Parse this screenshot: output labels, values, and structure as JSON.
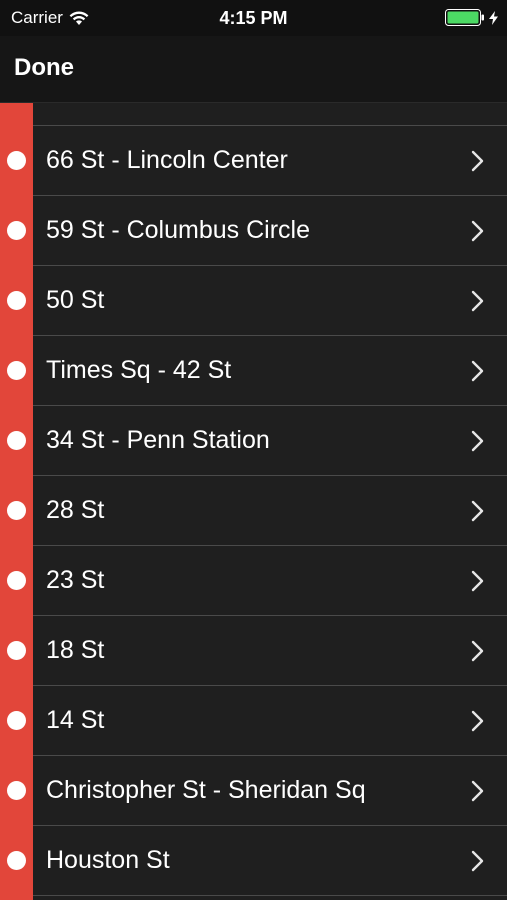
{
  "status_bar": {
    "carrier": "Carrier",
    "time": "4:15 PM",
    "battery_color": "#4cd964"
  },
  "nav": {
    "done_label": "Done"
  },
  "route_color": "#e2463a",
  "stations": [
    {
      "name": "66 St - Lincoln Center"
    },
    {
      "name": "59 St - Columbus Circle"
    },
    {
      "name": "50 St"
    },
    {
      "name": "Times Sq - 42 St"
    },
    {
      "name": "34 St - Penn Station"
    },
    {
      "name": "28 St"
    },
    {
      "name": "23 St"
    },
    {
      "name": "18 St"
    },
    {
      "name": "14 St"
    },
    {
      "name": "Christopher St - Sheridan Sq"
    },
    {
      "name": "Houston St"
    }
  ]
}
